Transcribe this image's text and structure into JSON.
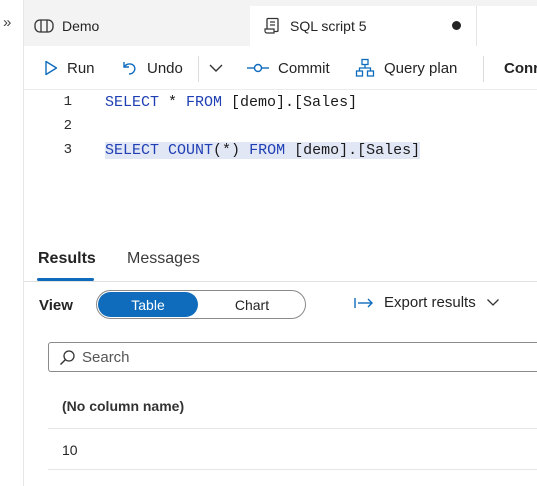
{
  "left_rail": {
    "expand_glyph": "»"
  },
  "tabs": [
    {
      "label": "Demo",
      "icon": "warehouse-icon"
    },
    {
      "label": "SQL script 5",
      "icon": "script-icon",
      "unsaved": true
    }
  ],
  "toolbar": {
    "run": "Run",
    "undo": "Undo",
    "commit": "Commit",
    "query_plan": "Query plan",
    "connect_partial": "Conr"
  },
  "editor": {
    "lines": [
      {
        "number": "1",
        "code": "SELECT * FROM [demo].[Sales]"
      },
      {
        "number": "2",
        "code": ""
      },
      {
        "number": "3",
        "code": "SELECT COUNT(*) FROM [demo].[Sales]"
      }
    ]
  },
  "results": {
    "tabs": [
      "Results",
      "Messages"
    ],
    "view_label": "View",
    "view_options": [
      "Table",
      "Chart"
    ],
    "export_label": "Export results",
    "search_placeholder": "Search",
    "columns": [
      "(No column name)"
    ],
    "rows": [
      [
        "10"
      ]
    ]
  },
  "colors": {
    "accent": "#0f6cbd",
    "keyword": "#1f3fb3",
    "selection": "#e2e7f6"
  }
}
